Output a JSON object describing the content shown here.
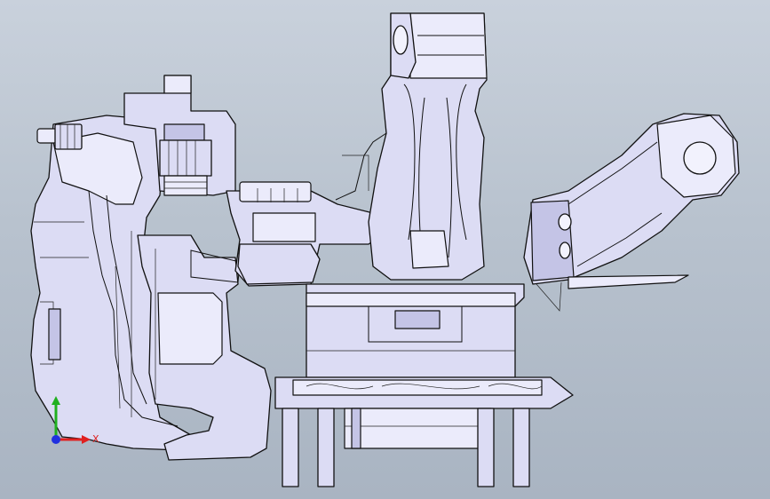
{
  "viewport": {
    "background_top": "#c9d1dc",
    "background_bottom": "#a9b4c2",
    "part_fill": "#dcdcf4",
    "edge_color": "#111111"
  },
  "triad": {
    "x_label": "X",
    "x_color": "#e02020",
    "y_color": "#20b020",
    "z_color": "#2030e0"
  }
}
